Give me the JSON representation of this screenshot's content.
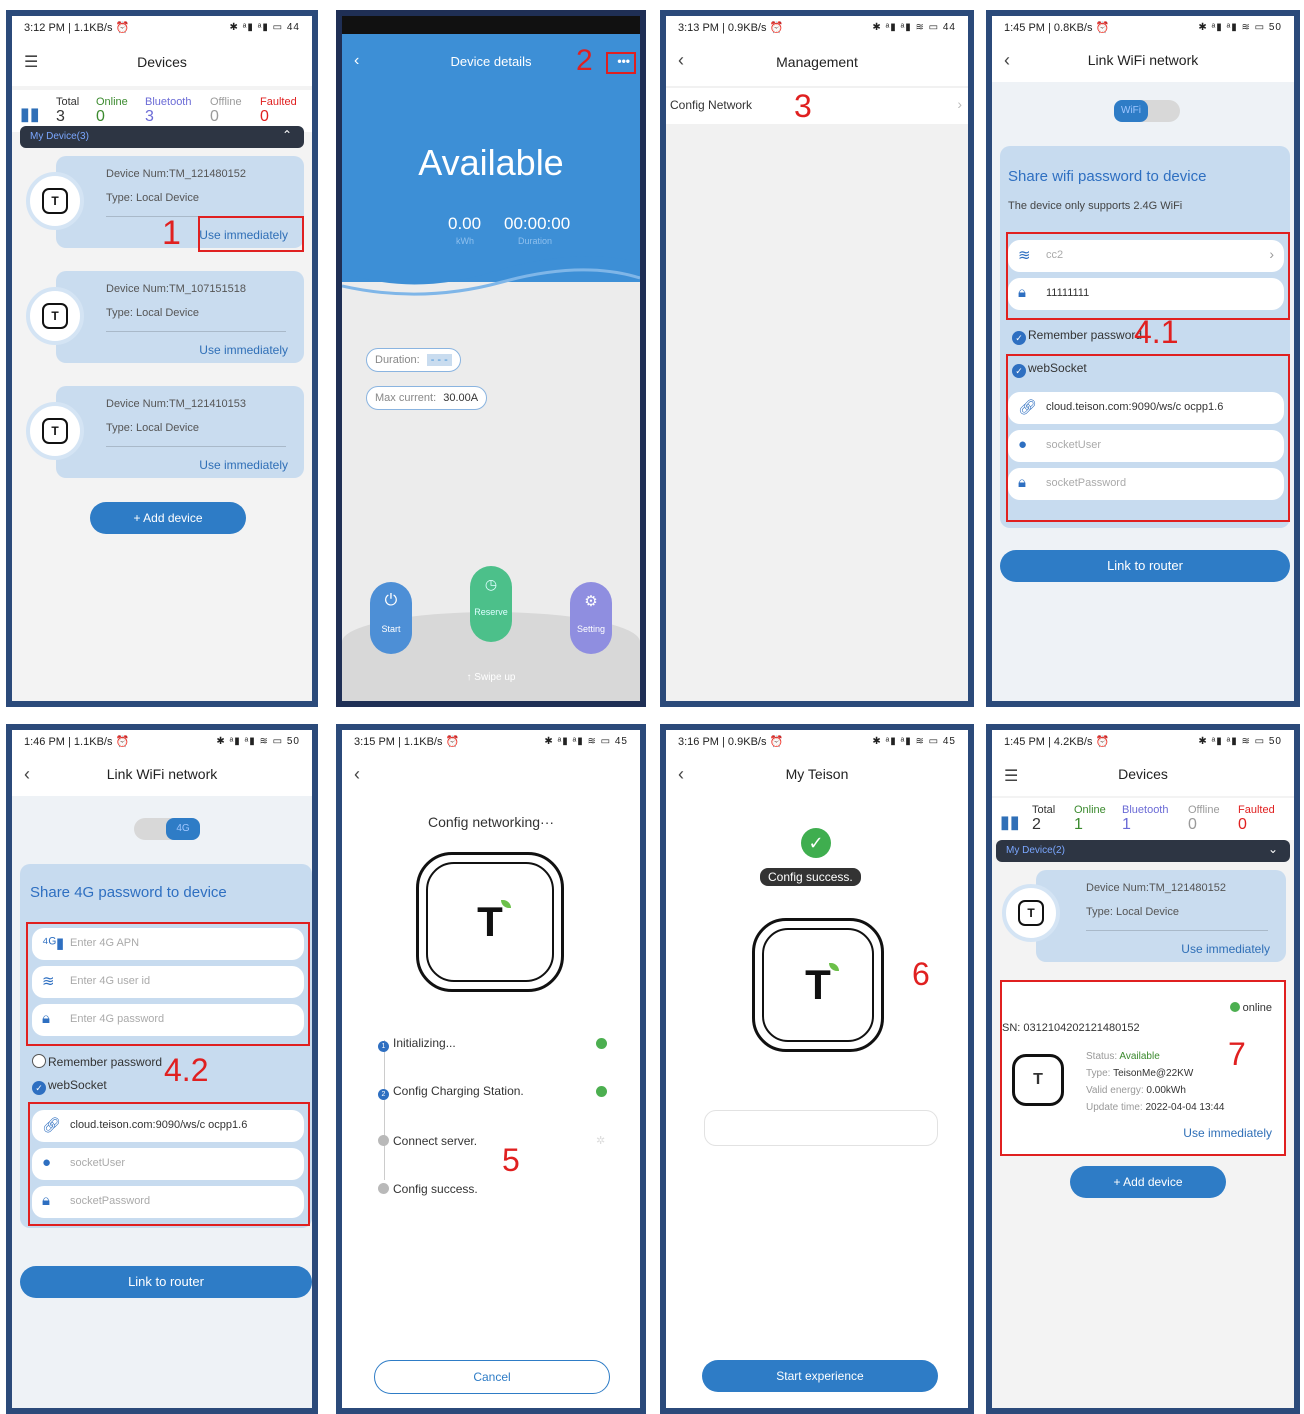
{
  "colors": {
    "accent": "#2e7cc6",
    "annotation_red": "#e02020",
    "card_blue": "#c9dcef",
    "online_green": "#4caf50"
  },
  "annotations": [
    "1",
    "2",
    "3",
    "4.1",
    "4.2",
    "5",
    "6",
    "7"
  ],
  "screen1": {
    "status_left": "3:12 PM | 1.1KB/s ⏰",
    "status_right": "✱ ᵃ▮ ᵃ▮ ▭ 44",
    "title": "Devices",
    "counts": [
      {
        "label": "Total",
        "value": "3",
        "color": "#333333"
      },
      {
        "label": "Online",
        "value": "0",
        "color": "#3b8a2e"
      },
      {
        "label": "Bluetooth",
        "value": "3",
        "color": "#6b6bd6"
      },
      {
        "label": "Offline",
        "value": "0",
        "color": "#9a9a9a"
      },
      {
        "label": "Faulted",
        "value": "0",
        "color": "#e02020"
      }
    ],
    "my_device": "My Device(3)",
    "devices": [
      {
        "num": "Device Num:TM_121480152",
        "type": "Type:  Local Device",
        "action": "Use immediately"
      },
      {
        "num": "Device Num:TM_107151518",
        "type": "Type:  Local Device",
        "action": "Use immediately"
      },
      {
        "num": "Device Num:TM_121410153",
        "type": "Type:  Local Device",
        "action": "Use immediately"
      }
    ],
    "add_device": "+  Add device"
  },
  "screen2": {
    "title": "Device details",
    "more": "•••",
    "state": "Available",
    "energy": "0.00",
    "energy_unit": "kWh",
    "duration": "00:00:00",
    "duration_label": "Duration",
    "duration_field": "Duration:",
    "duration_value": "- - -",
    "max_current_label": "Max current:",
    "max_current_value": "30.00A",
    "buttons": [
      "Start",
      "Reserve",
      "Setting"
    ],
    "swipe": "↑ Swipe up"
  },
  "screen3": {
    "status_left": "3:13 PM | 0.9KB/s ⏰",
    "status_right": "✱ ᵃ▮ ᵃ▮ ≋ ▭ 44",
    "title": "Management",
    "item": "Config Network"
  },
  "screen4": {
    "status_left": "1:45 PM | 0.8KB/s ⏰",
    "status_right": "✱ ᵃ▮ ᵃ▮ ≋ ▭ 50",
    "title": "Link WiFi network",
    "toggle": "WiFi",
    "heading": "Share wifi password to device",
    "note": "The device only supports 2.4G WiFi",
    "ssid": "cc2",
    "password": "11111111",
    "remember": "Remember password",
    "websocket": "webSocket",
    "url": "cloud.teison.com:9090/ws/c    ocpp1.6",
    "user_ph": "socketUser",
    "pass_ph": "socketPassword",
    "link": "Link to router"
  },
  "screen5": {
    "status_left": "1:46 PM | 1.1KB/s ⏰",
    "status_right": "✱ ᵃ▮ ᵃ▮ ≋ ▭ 50",
    "title": "Link WiFi network",
    "toggle": "4G",
    "heading": "Share 4G password to device",
    "apn_ph": "Enter 4G APN",
    "user_id_ph": "Enter 4G user id",
    "pwd_ph": "Enter 4G password",
    "remember": "Remember password",
    "websocket": "webSocket",
    "url": "cloud.teison.com:9090/ws/c    ocpp1.6",
    "user_ph": "socketUser",
    "pass_ph": "socketPassword",
    "link": "Link to router"
  },
  "screen6": {
    "status_left": "3:15 PM | 1.1KB/s ⏰",
    "status_right": "✱ ᵃ▮ ᵃ▮ ≋ ▭ 45",
    "title": "Config networking···",
    "steps": [
      "Initializing...",
      "Config Charging Station.",
      "Connect server.",
      "Config success."
    ],
    "cancel": "Cancel"
  },
  "screen7": {
    "status_left": "3:16 PM | 0.9KB/s ⏰",
    "status_right": "✱ ᵃ▮ ᵃ▮ ≋ ▭ 45",
    "title": "My Teison",
    "success": "Config success.",
    "start": "Start experience"
  },
  "screen8": {
    "status_left": "1:45 PM | 4.2KB/s ⏰",
    "status_right": "✱ ᵃ▮ ᵃ▮ ≋ ▭ 50",
    "title": "Devices",
    "counts": [
      {
        "label": "Total",
        "value": "2",
        "color": "#333333"
      },
      {
        "label": "Online",
        "value": "1",
        "color": "#3b8a2e"
      },
      {
        "label": "Bluetooth",
        "value": "1",
        "color": "#6b6bd6"
      },
      {
        "label": "Offline",
        "value": "0",
        "color": "#9a9a9a"
      },
      {
        "label": "Faulted",
        "value": "0",
        "color": "#e02020"
      }
    ],
    "my_device": "My Device(2)",
    "device": {
      "num": "Device Num:TM_121480152",
      "type": "Type:  Local Device",
      "action": "Use immediately"
    },
    "online": "online",
    "sn": "SN:  0312104202121480152",
    "status_label": "Status:",
    "status_value": "Available",
    "type_label": "Type:",
    "type_value": "TeisonMe@22KW",
    "energy_label": "Valid energy:",
    "energy_value": "0.00kWh",
    "update_label": "Update time:",
    "update_value": "2022-04-04 13:44",
    "action": "Use immediately",
    "add_device": "+  Add device"
  }
}
